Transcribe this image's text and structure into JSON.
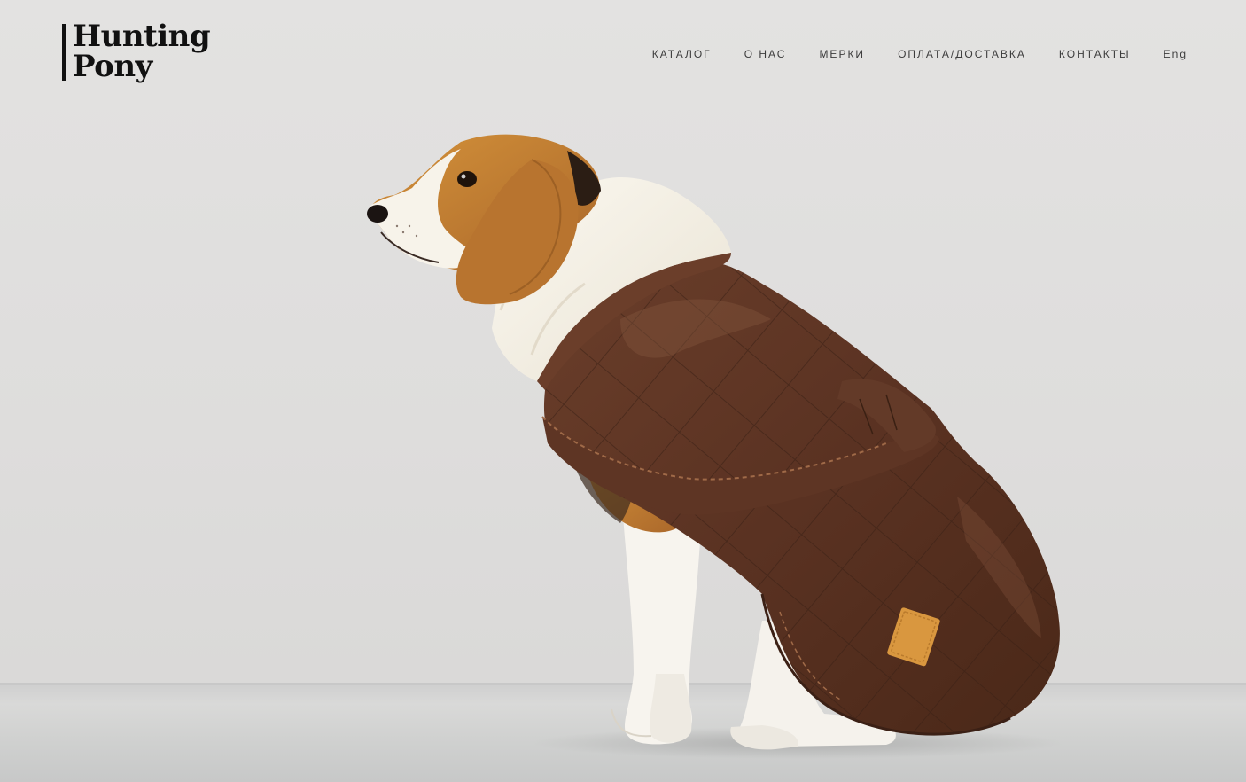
{
  "header": {
    "logo": {
      "line1": "Hunting",
      "line2": "Pony"
    },
    "nav": [
      {
        "label": "КАТАЛОГ"
      },
      {
        "label": "О НАС"
      },
      {
        "label": "МЕРКИ"
      },
      {
        "label": "ОПЛАТА/ДОСТАВКА"
      },
      {
        "label": "КОНТАКТЫ"
      },
      {
        "label": "Eng"
      }
    ]
  },
  "hero": {
    "image": "beagle-wearing-brown-quilted-coat-with-sherpa-collar",
    "colors": {
      "background": "#e0dfde",
      "coat": "#5a3322",
      "collar": "#f4f0e6",
      "tag": "#d9973f"
    }
  }
}
